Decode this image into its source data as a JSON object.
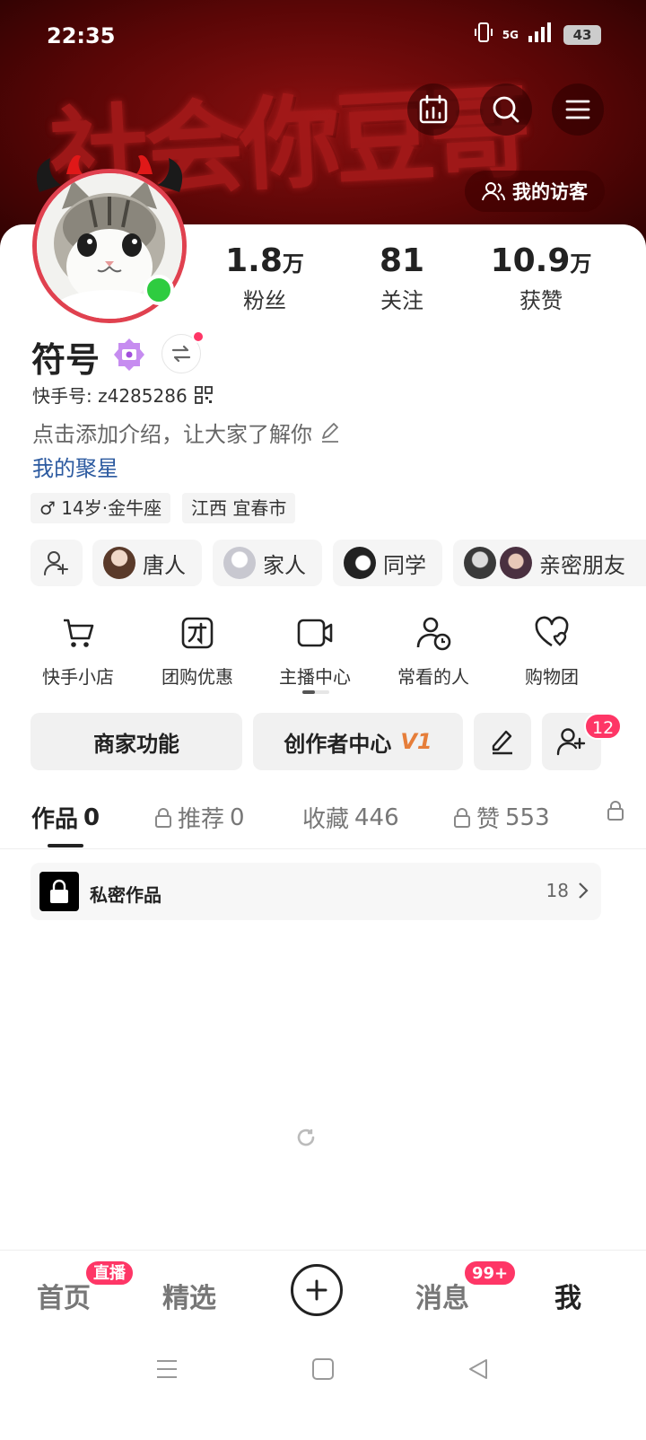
{
  "status_bar": {
    "time": "22:35",
    "network": "5G",
    "battery": "43"
  },
  "banner": {
    "text": "社会你豆哥",
    "visitors_label": "我的访客"
  },
  "profile": {
    "name": "符号",
    "kuaishou_id_label": "快手号: z4285286",
    "intro_placeholder": "点击添加介绍，让大家了解你",
    "link": "我的聚星",
    "tags": [
      "14岁·金牛座",
      "江西 宜春市"
    ]
  },
  "stats": [
    {
      "num": "1.8",
      "unit": "万",
      "label": "粉丝"
    },
    {
      "num": "81",
      "unit": "",
      "label": "关注"
    },
    {
      "num": "10.9",
      "unit": "万",
      "label": "获赞"
    }
  ],
  "relations": [
    "唐人",
    "家人",
    "同学",
    "亲密朋友"
  ],
  "functions": [
    "快手小店",
    "团购优惠",
    "主播中心",
    "常看的人",
    "购物团"
  ],
  "actions": {
    "merchant": "商家功能",
    "creator": "创作者中心",
    "creator_level": "V1",
    "friend_requests": "12"
  },
  "tabs": [
    {
      "label": "作品",
      "count": "0",
      "locked": false
    },
    {
      "label": "推荐",
      "count": "0",
      "locked": true
    },
    {
      "label": "收藏",
      "count": "446",
      "locked": false
    },
    {
      "label": "赞",
      "count": "553",
      "locked": true
    }
  ],
  "private_works": {
    "title": "私密作品",
    "count": "18"
  },
  "bottom_nav": {
    "home": "首页",
    "home_badge": "直播",
    "featured": "精选",
    "messages": "消息",
    "messages_badge": "99+",
    "me": "我"
  },
  "colors": {
    "accent": "#fe3666",
    "banner": "#5a0606",
    "online": "#2ecc40",
    "link": "#2c5aa0"
  }
}
